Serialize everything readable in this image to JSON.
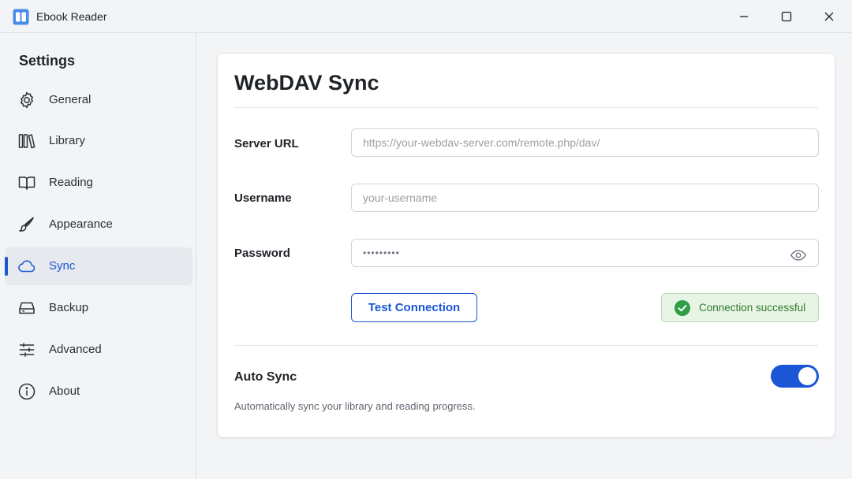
{
  "window": {
    "title": "Ebook Reader",
    "icon": "book-icon",
    "controls": [
      "minimize-icon",
      "maximize-icon",
      "close-icon"
    ]
  },
  "sidebar": {
    "heading": "Settings",
    "items": [
      {
        "label": "General",
        "icon": "gear-icon",
        "active": false
      },
      {
        "label": "Library",
        "icon": "books-icon",
        "active": false
      },
      {
        "label": "Reading",
        "icon": "open-book-icon",
        "active": false
      },
      {
        "label": "Appearance",
        "icon": "brush-icon",
        "active": false
      },
      {
        "label": "Sync",
        "icon": "cloud-icon",
        "active": true
      },
      {
        "label": "Backup",
        "icon": "drive-icon",
        "active": false
      },
      {
        "label": "Advanced",
        "icon": "sliders-icon",
        "active": false
      },
      {
        "label": "About",
        "icon": "info-icon",
        "active": false
      }
    ]
  },
  "main": {
    "title": "WebDAV Sync",
    "fields": {
      "server_url": {
        "label": "Server URL",
        "value": "",
        "placeholder": "https://your-webdav-server.com/remote.php/dav/"
      },
      "username": {
        "label": "Username",
        "value": "",
        "placeholder": "your-username"
      },
      "password": {
        "label": "Password",
        "value": "•••••••••",
        "placeholder": ""
      }
    },
    "test_button": "Test Connection",
    "status": {
      "text": "Connection successful",
      "icon": "check-circle-icon",
      "color": "#2f9e44"
    },
    "auto_sync": {
      "label": "Auto Sync",
      "description": "Automatically sync your library and reading progress.",
      "enabled": true
    }
  },
  "colors": {
    "accent": "#1a56d6",
    "success_bg": "#e8f5e6",
    "success_text": "#2f7a2f"
  }
}
